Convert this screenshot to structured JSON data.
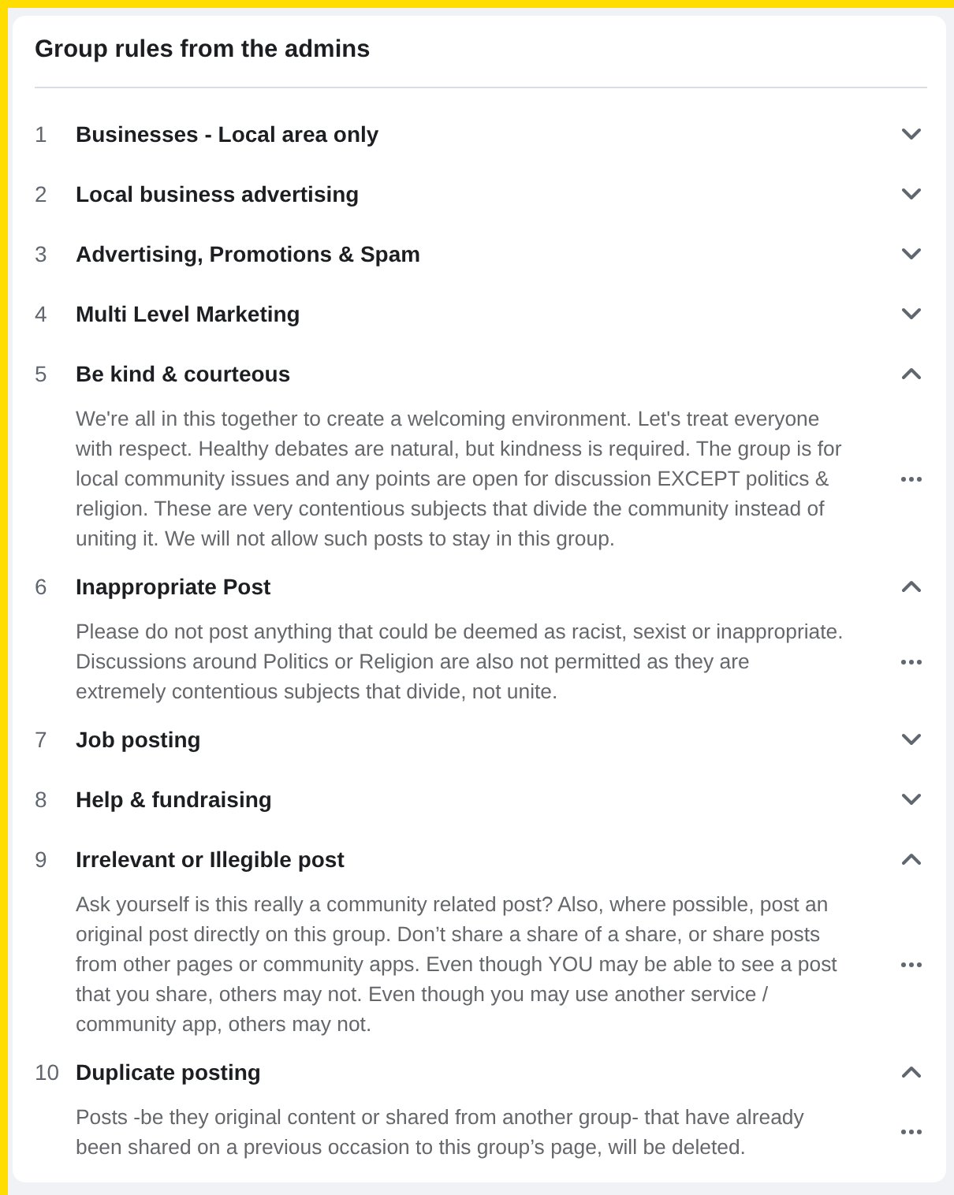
{
  "title": "Group rules from the admins",
  "rules": [
    {
      "number": "1",
      "title": "Businesses - Local area only",
      "expanded": false
    },
    {
      "number": "2",
      "title": "Local business advertising",
      "expanded": false
    },
    {
      "number": "3",
      "title": "Advertising, Promotions & Spam",
      "expanded": false
    },
    {
      "number": "4",
      "title": "Multi Level Marketing",
      "expanded": false
    },
    {
      "number": "5",
      "title": "Be kind & courteous",
      "expanded": true,
      "description": "We're all in this together to create a welcoming environment. Let's treat everyone with respect. Healthy debates are natural, but kindness is required. The group is for local community issues and any points are open for discussion EXCEPT politics & religion. These are very contentious subjects that divide the community instead of uniting it. We will not allow such posts to stay in this group."
    },
    {
      "number": "6",
      "title": "Inappropriate Post",
      "expanded": true,
      "description": "Please do not post anything that could be deemed as racist, sexist or inappropriate. Discussions around Politics or Religion are also not permitted as they are extremely contentious subjects that divide, not unite."
    },
    {
      "number": "7",
      "title": "Job posting",
      "expanded": false
    },
    {
      "number": "8",
      "title": "Help & fundraising",
      "expanded": false
    },
    {
      "number": "9",
      "title": "Irrelevant or Illegible post",
      "expanded": true,
      "description": "Ask yourself is this really a community related post? Also, where possible, post an original post directly on this group. Don’t share a share of a share, or share posts from other pages or community apps. Even though YOU may be able to see a post that you share, others may not. Even though you may use another service / community app, others may not."
    },
    {
      "number": "10",
      "title": "Duplicate posting",
      "expanded": true,
      "description": "Posts -be they original content or shared from another group- that have already been shared on a previous occasion to this group’s page, will be deleted."
    }
  ]
}
